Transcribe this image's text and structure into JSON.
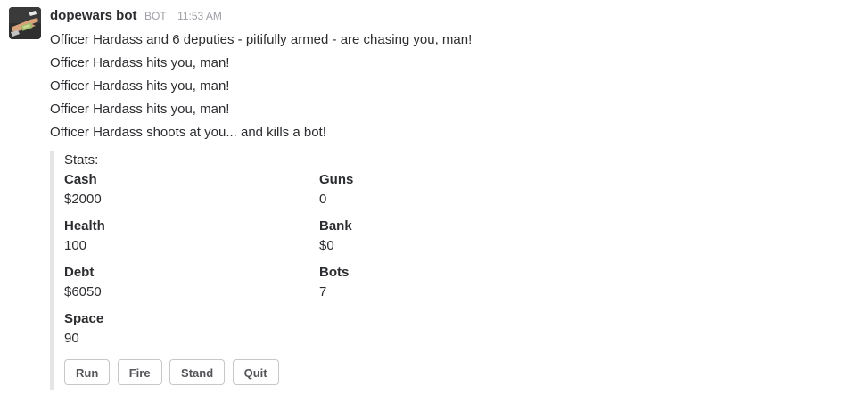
{
  "message": {
    "sender": "dopewars bot",
    "badge": "BOT",
    "timestamp": "11:53 AM",
    "lines": [
      "Officer Hardass and 6 deputies - pitifully armed - are chasing you, man!",
      "Officer Hardass hits you, man!",
      "Officer Hardass hits you, man!",
      "Officer Hardass hits you, man!",
      "Officer Hardass shoots at you... and kills a bot!"
    ]
  },
  "attachment": {
    "pretext": "Stats:",
    "fields": [
      {
        "title": "Cash",
        "value": "$2000"
      },
      {
        "title": "Guns",
        "value": "0"
      },
      {
        "title": "Health",
        "value": "100"
      },
      {
        "title": "Bank",
        "value": "$0"
      },
      {
        "title": "Debt",
        "value": "$6050"
      },
      {
        "title": "Bots",
        "value": "7"
      },
      {
        "title": "Space",
        "value": "90"
      }
    ],
    "accent_color": "#e5e5e5"
  },
  "actions": [
    {
      "label": "Run"
    },
    {
      "label": "Fire"
    },
    {
      "label": "Stand"
    },
    {
      "label": "Quit"
    }
  ],
  "icons": {
    "avatar": "hand-with-money-icon"
  }
}
